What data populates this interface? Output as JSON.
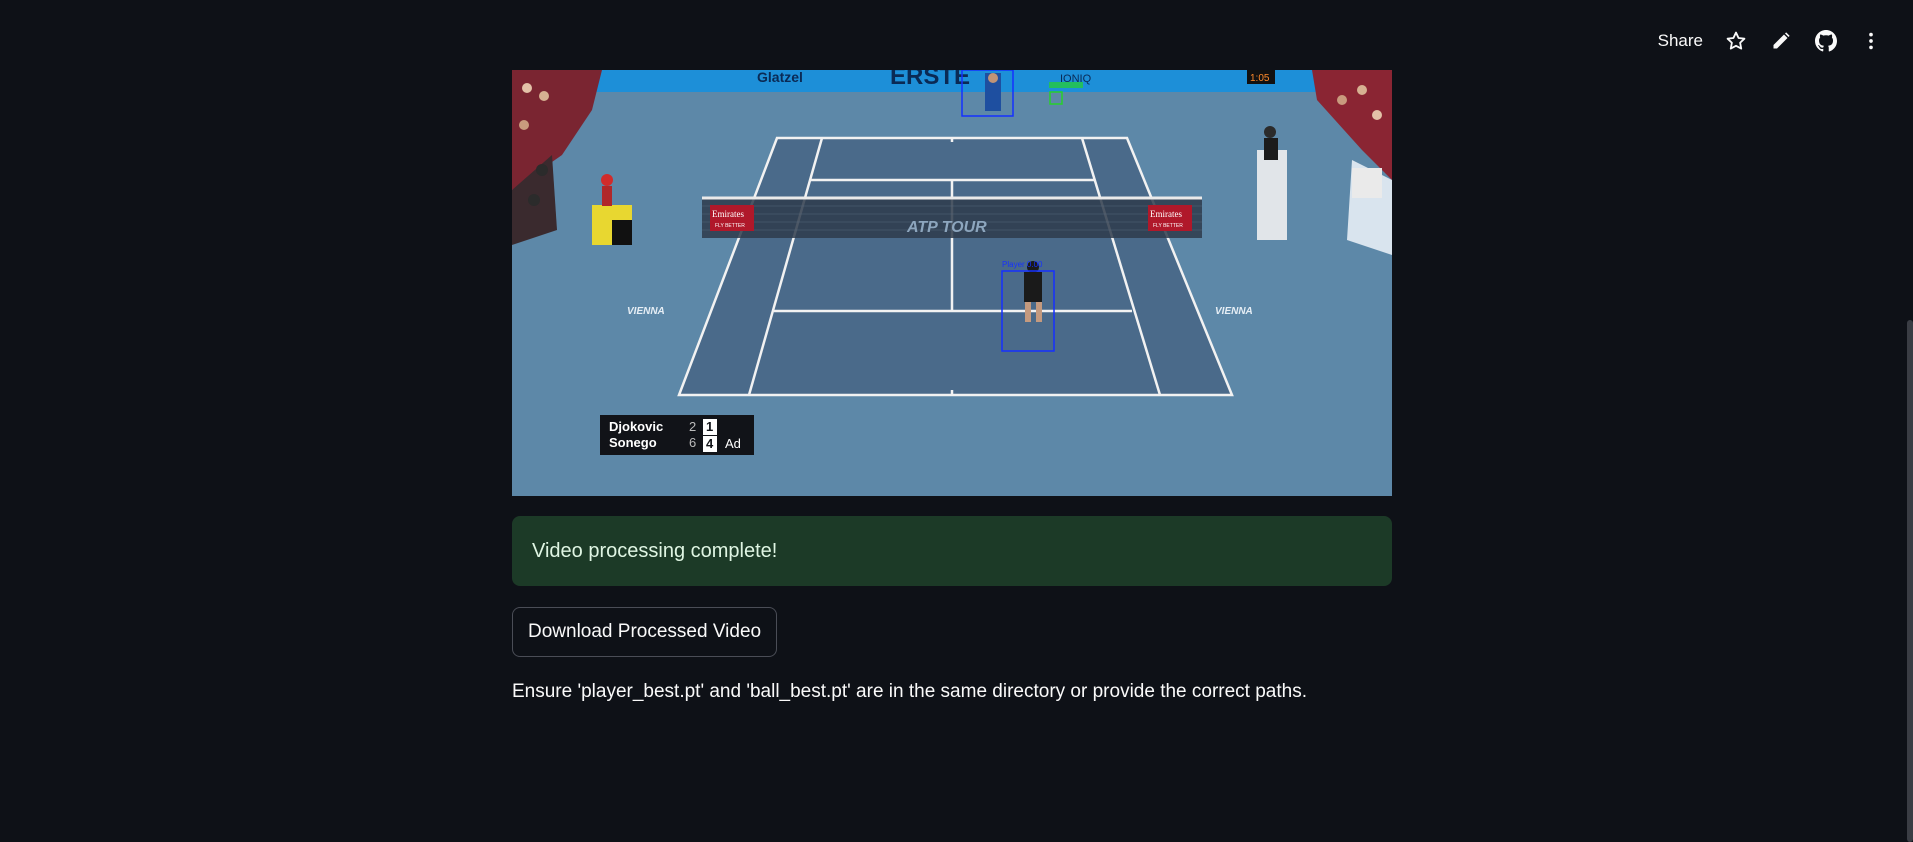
{
  "toolbar": {
    "share_label": "Share",
    "icons": [
      "star-icon",
      "pencil-icon",
      "github-icon",
      "more-vertical-icon"
    ]
  },
  "video_frame": {
    "sponsor_top_1": "Glatzel",
    "sponsor_top_2": "ERSTE",
    "sponsor_top_3": "IONIQ",
    "court_logo": "ATP TOUR",
    "net_banner": "Emirates",
    "net_banner_sub": "FLY BETTER",
    "city_left": "VIENNA",
    "city_right": "VIENNA",
    "clock": "1:05",
    "detection_label": "Player 0.00",
    "scoreboard": {
      "rows": [
        {
          "name": "Djokovic",
          "sets": "2",
          "games": "1",
          "points": ""
        },
        {
          "name": "Sonego",
          "sets": "6",
          "games": "4",
          "points": "Ad"
        }
      ]
    }
  },
  "status": {
    "message": "Video processing complete!",
    "color": "#1c3a27"
  },
  "download_button_label": "Download Processed Video",
  "note": "Ensure 'player_best.pt' and 'ball_best.pt' are in the same directory or provide the correct paths."
}
